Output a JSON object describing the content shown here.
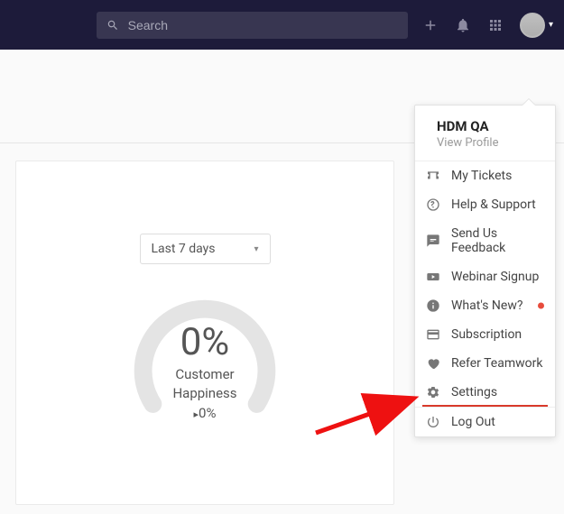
{
  "search": {
    "placeholder": "Search"
  },
  "card": {
    "range_label": "Last 7 days",
    "percent": "0%",
    "metric_label_1": "Customer",
    "metric_label_2": "Happiness",
    "delta": "0%"
  },
  "menu": {
    "username": "HDM QA",
    "view_profile": "View Profile",
    "items": [
      {
        "label": "My Tickets"
      },
      {
        "label": "Help & Support"
      },
      {
        "label": "Send Us Feedback"
      },
      {
        "label": "Webinar Signup"
      },
      {
        "label": "What's New?"
      },
      {
        "label": "Subscription"
      },
      {
        "label": "Refer Teamwork"
      },
      {
        "label": "Settings"
      },
      {
        "label": "Log Out"
      }
    ]
  }
}
